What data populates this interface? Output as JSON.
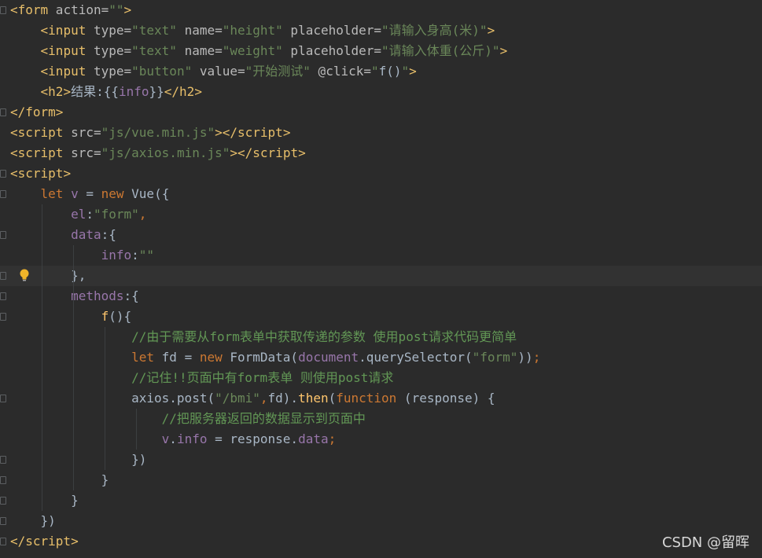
{
  "editor": {
    "colors": {
      "background": "#2b2b2b",
      "current_line": "#323232",
      "tag": "#e8bf6a",
      "attribute": "#bababa",
      "string": "#6a8759",
      "keyword": "#cc7832",
      "property": "#9876aa",
      "comment": "#629755",
      "default": "#a9b7c6"
    },
    "lines": [
      {
        "tokens": [
          [
            "<",
            "#e8bf6a"
          ],
          [
            "form",
            "#e8bf6a"
          ],
          [
            " action=",
            "#bababa"
          ],
          [
            "\"\"",
            "#6a8759"
          ],
          [
            ">",
            "#e8bf6a"
          ]
        ]
      },
      {
        "tokens": [
          [
            "    <",
            "#e8bf6a"
          ],
          [
            "input",
            "#e8bf6a"
          ],
          [
            " type=",
            "#bababa"
          ],
          [
            "\"text\"",
            "#6a8759"
          ],
          [
            " name=",
            "#bababa"
          ],
          [
            "\"height\"",
            "#6a8759"
          ],
          [
            " placeholder=",
            "#bababa"
          ],
          [
            "\"请输入身高(米)\"",
            "#6a8759"
          ],
          [
            ">",
            "#e8bf6a"
          ]
        ]
      },
      {
        "tokens": [
          [
            "    <",
            "#e8bf6a"
          ],
          [
            "input",
            "#e8bf6a"
          ],
          [
            " type=",
            "#bababa"
          ],
          [
            "\"text\"",
            "#6a8759"
          ],
          [
            " name=",
            "#bababa"
          ],
          [
            "\"weight\"",
            "#6a8759"
          ],
          [
            " placeholder=",
            "#bababa"
          ],
          [
            "\"请输入体重(公斤)\"",
            "#6a8759"
          ],
          [
            ">",
            "#e8bf6a"
          ]
        ]
      },
      {
        "tokens": [
          [
            "    <",
            "#e8bf6a"
          ],
          [
            "input",
            "#e8bf6a"
          ],
          [
            " type=",
            "#bababa"
          ],
          [
            "\"button\"",
            "#6a8759"
          ],
          [
            " value=",
            "#bababa"
          ],
          [
            "\"开始测试\"",
            "#6a8759"
          ],
          [
            " @click=",
            "#bababa"
          ],
          [
            "\"",
            "#6a8759"
          ],
          [
            "f()",
            "#a9b7c6"
          ],
          [
            "\"",
            "#6a8759"
          ],
          [
            ">",
            "#e8bf6a"
          ]
        ]
      },
      {
        "tokens": [
          [
            "    <",
            "#e8bf6a"
          ],
          [
            "h2",
            "#e8bf6a"
          ],
          [
            ">",
            "#e8bf6a"
          ],
          [
            "结果:{{",
            "#a9b7c6"
          ],
          [
            "info",
            "#9876aa"
          ],
          [
            "}}",
            "#a9b7c6"
          ],
          [
            "</",
            "#e8bf6a"
          ],
          [
            "h2",
            "#e8bf6a"
          ],
          [
            ">",
            "#e8bf6a"
          ]
        ]
      },
      {
        "tokens": [
          [
            "</",
            "#e8bf6a"
          ],
          [
            "form",
            "#e8bf6a"
          ],
          [
            ">",
            "#e8bf6a"
          ]
        ]
      },
      {
        "tokens": [
          [
            "<",
            "#e8bf6a"
          ],
          [
            "script",
            "#e8bf6a"
          ],
          [
            " src=",
            "#bababa"
          ],
          [
            "\"js/vue.min.js\"",
            "#6a8759"
          ],
          [
            "></",
            "#e8bf6a"
          ],
          [
            "script",
            "#e8bf6a"
          ],
          [
            ">",
            "#e8bf6a"
          ]
        ]
      },
      {
        "tokens": [
          [
            "<",
            "#e8bf6a"
          ],
          [
            "script",
            "#e8bf6a"
          ],
          [
            " src=",
            "#bababa"
          ],
          [
            "\"js/axios.min.js\"",
            "#6a8759"
          ],
          [
            "></",
            "#e8bf6a"
          ],
          [
            "script",
            "#e8bf6a"
          ],
          [
            ">",
            "#e8bf6a"
          ]
        ]
      },
      {
        "tokens": [
          [
            "<",
            "#e8bf6a"
          ],
          [
            "script",
            "#e8bf6a"
          ],
          [
            ">",
            "#e8bf6a"
          ]
        ]
      },
      {
        "tokens": [
          [
            "    ",
            "#a9b7c6"
          ],
          [
            "let",
            "#cc7832"
          ],
          [
            " ",
            "#a9b7c6"
          ],
          [
            "v",
            "#9876aa"
          ],
          [
            " = ",
            "#a9b7c6"
          ],
          [
            "new",
            "#cc7832"
          ],
          [
            " Vue({",
            "#a9b7c6"
          ]
        ]
      },
      {
        "tokens": [
          [
            "        ",
            "#a9b7c6"
          ],
          [
            "el",
            "#9876aa"
          ],
          [
            ":",
            "#a9b7c6"
          ],
          [
            "\"form\"",
            "#6a8759"
          ],
          [
            ",",
            "#cc7832"
          ]
        ]
      },
      {
        "tokens": [
          [
            "        ",
            "#a9b7c6"
          ],
          [
            "data",
            "#9876aa"
          ],
          [
            ":{",
            "#a9b7c6"
          ]
        ]
      },
      {
        "tokens": [
          [
            "            ",
            "#a9b7c6"
          ],
          [
            "info",
            "#9876aa"
          ],
          [
            ":",
            "#a9b7c6"
          ],
          [
            "\"\"",
            "#6a8759"
          ]
        ]
      },
      {
        "tokens": [
          [
            "        },",
            "#a9b7c6"
          ]
        ],
        "current": true,
        "bulb": true
      },
      {
        "tokens": [
          [
            "        ",
            "#a9b7c6"
          ],
          [
            "methods",
            "#9876aa"
          ],
          [
            ":{",
            "#a9b7c6"
          ]
        ]
      },
      {
        "tokens": [
          [
            "            ",
            "#a9b7c6"
          ],
          [
            "f",
            "#ffc66d"
          ],
          [
            "(){",
            "#a9b7c6"
          ]
        ]
      },
      {
        "tokens": [
          [
            "                ",
            "#a9b7c6"
          ],
          [
            "//由于需要从form表单中获取传递的参数 使用post请求代码更简单",
            "#629755"
          ]
        ]
      },
      {
        "tokens": [
          [
            "                ",
            "#a9b7c6"
          ],
          [
            "let",
            "#cc7832"
          ],
          [
            " fd = ",
            "#a9b7c6"
          ],
          [
            "new",
            "#cc7832"
          ],
          [
            " FormData(",
            "#a9b7c6"
          ],
          [
            "document",
            "#9876aa"
          ],
          [
            ".querySelector(",
            "#a9b7c6"
          ],
          [
            "\"form\"",
            "#6a8759"
          ],
          [
            "))",
            "#a9b7c6"
          ],
          [
            ";",
            "#cc7832"
          ]
        ]
      },
      {
        "tokens": [
          [
            "                ",
            "#a9b7c6"
          ],
          [
            "//记住!!页面中有form表单 则使用post请求",
            "#629755"
          ]
        ]
      },
      {
        "tokens": [
          [
            "                axios.",
            "#a9b7c6"
          ],
          [
            "post",
            "#a9b7c6"
          ],
          [
            "(",
            "#a9b7c6"
          ],
          [
            "\"/bmi\"",
            "#6a8759"
          ],
          [
            ",",
            "#cc7832"
          ],
          [
            "fd).",
            "#a9b7c6"
          ],
          [
            "then",
            "#ffc66d"
          ],
          [
            "(",
            "#a9b7c6"
          ],
          [
            "function",
            "#cc7832"
          ],
          [
            " (response) {",
            "#a9b7c6"
          ]
        ]
      },
      {
        "tokens": [
          [
            "                    ",
            "#a9b7c6"
          ],
          [
            "//把服务器返回的数据显示到页面中",
            "#629755"
          ]
        ]
      },
      {
        "tokens": [
          [
            "                    ",
            "#a9b7c6"
          ],
          [
            "v",
            "#9876aa"
          ],
          [
            ".",
            "#a9b7c6"
          ],
          [
            "info",
            "#9876aa"
          ],
          [
            " = response.",
            "#a9b7c6"
          ],
          [
            "data",
            "#9876aa"
          ],
          [
            ";",
            "#cc7832"
          ]
        ]
      },
      {
        "tokens": [
          [
            "                })",
            "#a9b7c6"
          ]
        ]
      },
      {
        "tokens": [
          [
            "            }",
            "#a9b7c6"
          ]
        ]
      },
      {
        "tokens": [
          [
            "        }",
            "#a9b7c6"
          ]
        ]
      },
      {
        "tokens": [
          [
            "    })",
            "#a9b7c6"
          ]
        ]
      },
      {
        "tokens": [
          [
            "</",
            "#e8bf6a"
          ],
          [
            "script",
            "#e8bf6a"
          ],
          [
            ">",
            "#e8bf6a"
          ]
        ]
      }
    ]
  },
  "watermark": {
    "text": "CSDN @留晖"
  }
}
